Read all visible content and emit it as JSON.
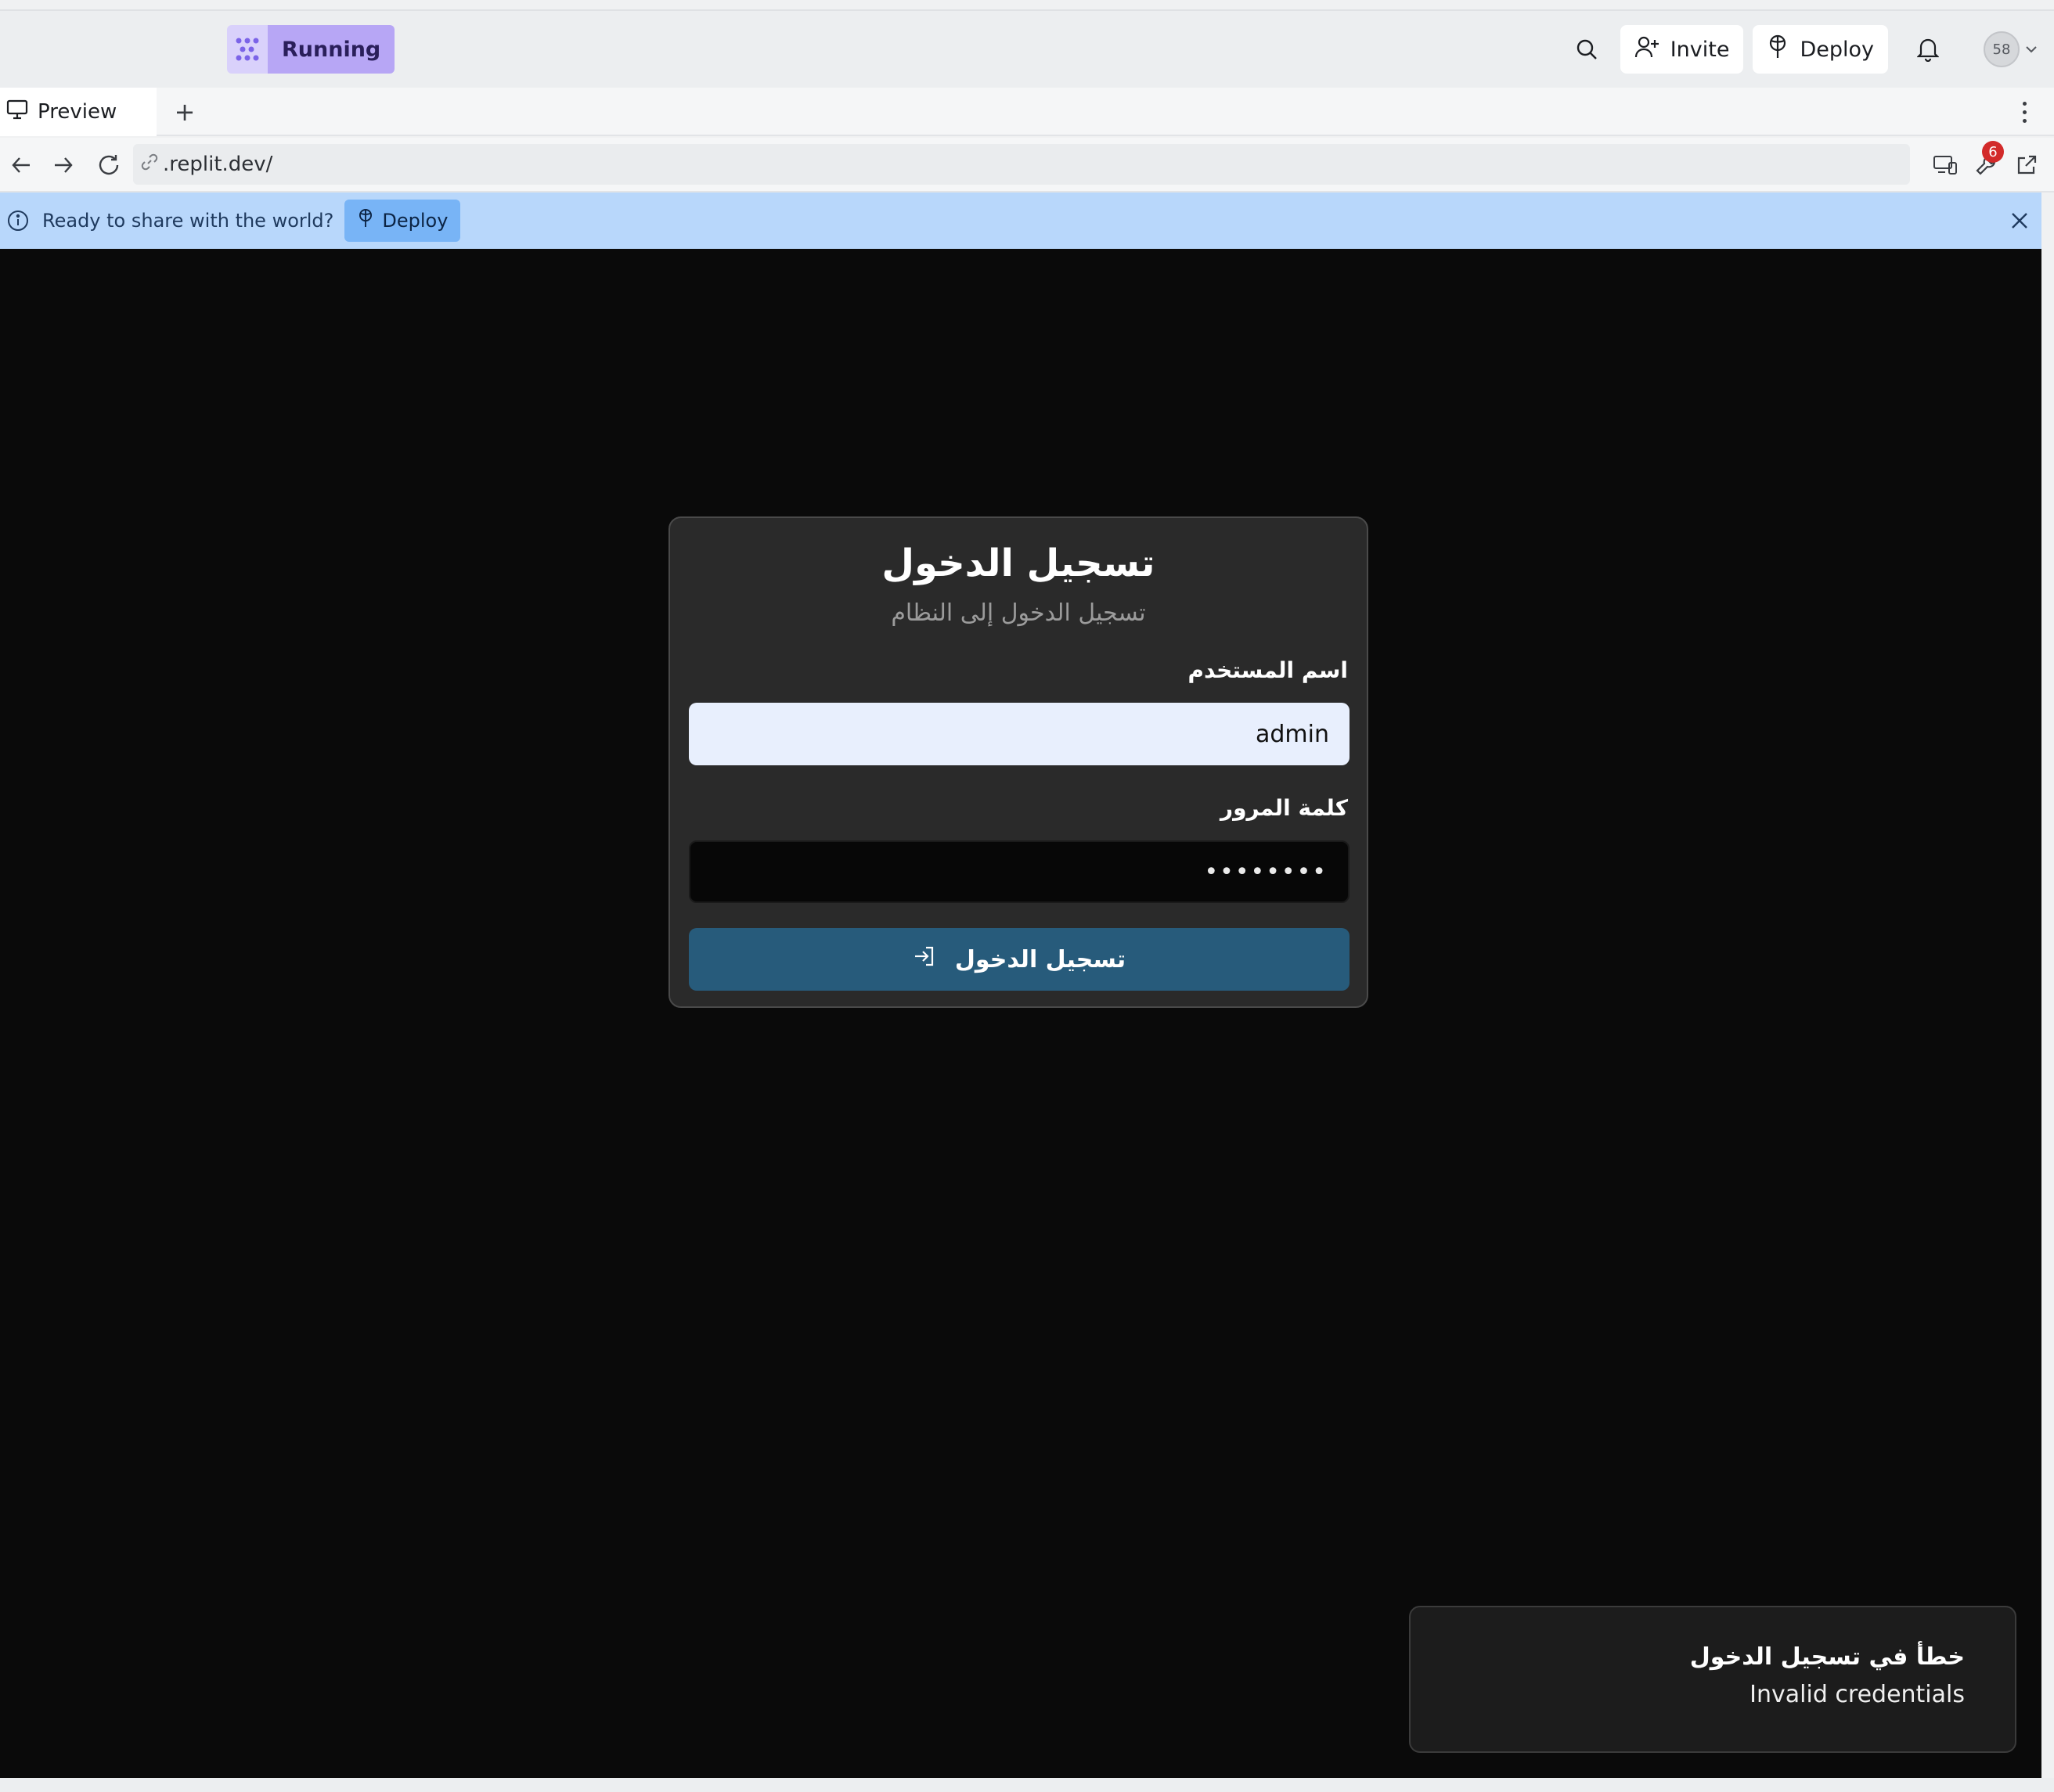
{
  "topbar": {
    "run_label": "Running",
    "invite_label": "Invite",
    "deploy_label": "Deploy",
    "avatar_text": "58"
  },
  "tabs": {
    "preview_label": "Preview",
    "add_label": "+"
  },
  "address": {
    "url": ".replit.dev/",
    "badge_count": "6"
  },
  "banner": {
    "text": "Ready to share with the world?",
    "deploy_label": "Deploy"
  },
  "login": {
    "title": "تسجيل الدخول",
    "subtitle": "تسجيل الدخول إلى النظام",
    "username_label": "اسم المستخدم",
    "username_value": "admin",
    "password_label": "كلمة المرور",
    "password_value": "••••••••",
    "submit_label": "تسجيل الدخول"
  },
  "toast": {
    "title": "خطأ في تسجيل الدخول",
    "message": "Invalid credentials"
  },
  "colors": {
    "run_button": "#b7a6f5",
    "banner_bg": "#b8d7fb",
    "submit_button": "#275b7b",
    "canvas_bg": "#0a0a0a"
  }
}
